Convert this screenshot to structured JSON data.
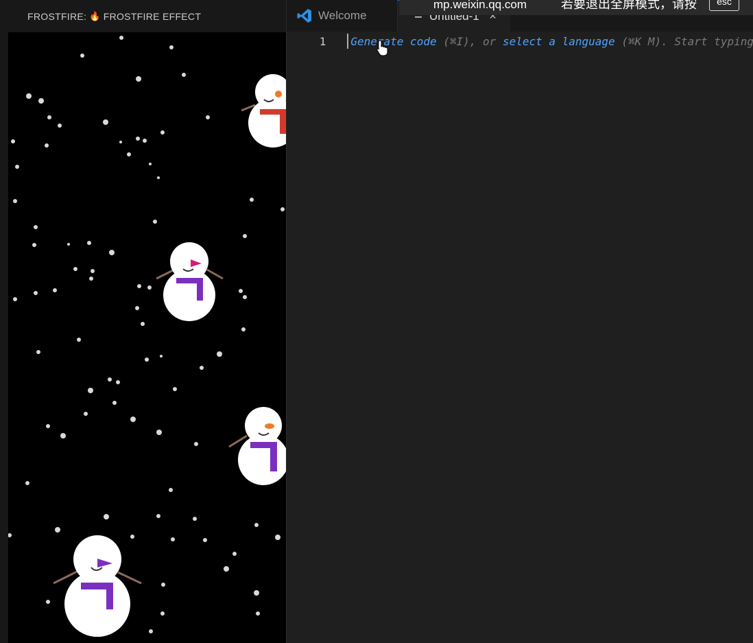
{
  "panel": {
    "title_prefix": "FROSTFIRE:",
    "title_icon": "fire-icon",
    "title_suffix": "FROSTFIRE EFFECT"
  },
  "tabs": [
    {
      "label": "Welcome",
      "icon": "vscode-icon"
    },
    {
      "label": "Untitled-1",
      "icon": "lines-icon"
    }
  ],
  "overlay": {
    "url": "mp.weixin.qq.com",
    "message": "若要退出全屏模式，请按",
    "key": "esc"
  },
  "editor": {
    "line_number": "1",
    "hint": {
      "generate_link": "Generate code",
      "generate_shortcut": "(⌘I), or",
      "select_link": "select a language",
      "select_shortcut": "(⌘K M). Start typing"
    }
  },
  "colors": {
    "accent": "#3a78d6",
    "link": "#4fa3ff",
    "scarf_red": "#d33a2c",
    "scarf_purple": "#7b2fbf"
  }
}
